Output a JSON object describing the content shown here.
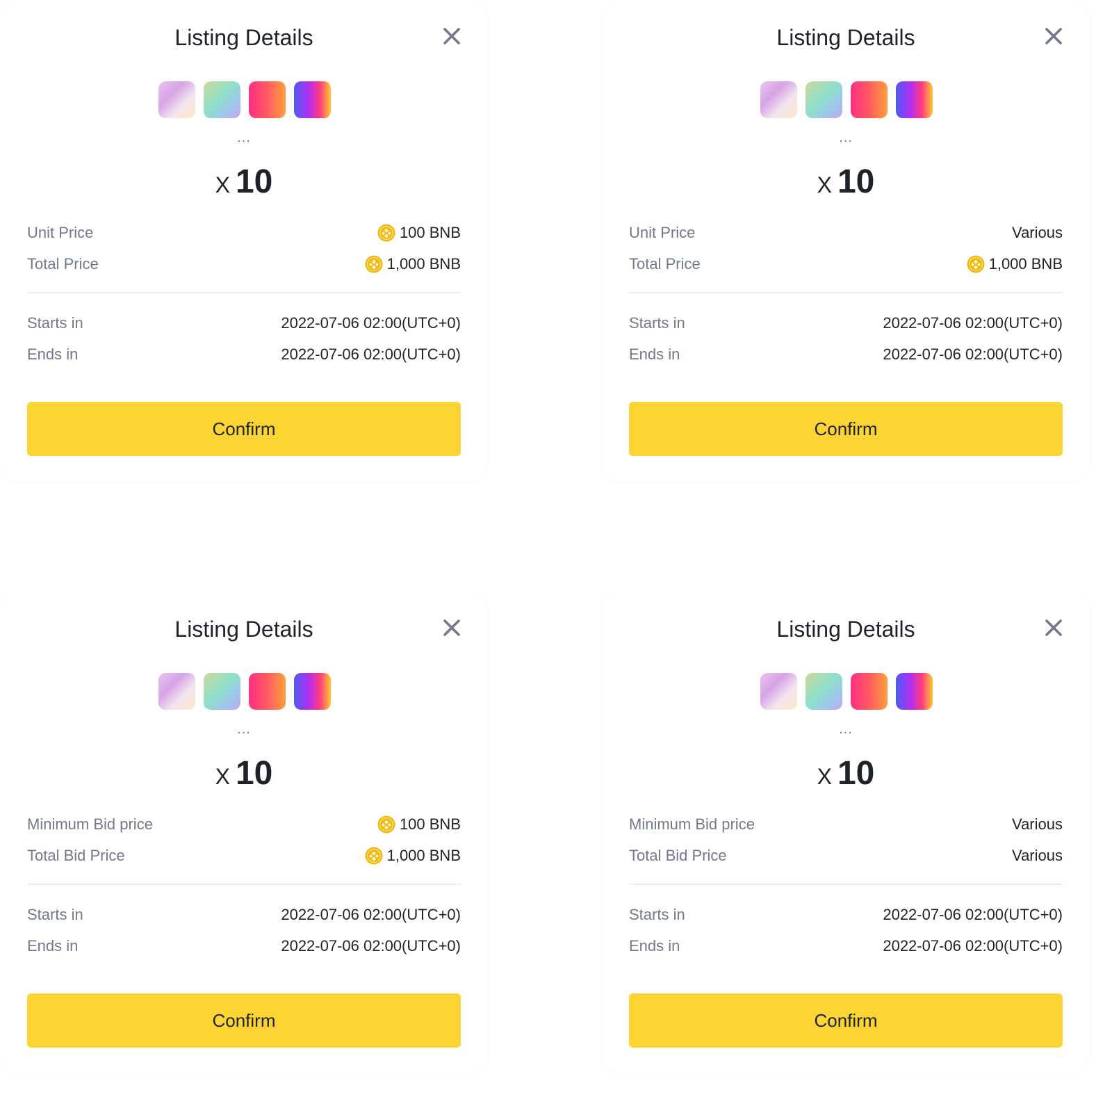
{
  "colors": {
    "accent_yellow": "#FCD535",
    "text_primary": "#1E2329",
    "text_secondary": "#707A8A",
    "divider": "#EAECEF",
    "bnb_coin": "#F0B90B"
  },
  "icons": {
    "close": "close-icon",
    "coin": "bnb-coin-icon"
  },
  "modals": [
    {
      "title": "Listing Details",
      "more_indicator": "...",
      "quantity_prefix": "X",
      "quantity": "10",
      "price_rows": [
        {
          "label": "Unit Price",
          "value": "100 BNB",
          "show_coin": true
        },
        {
          "label": "Total Price",
          "value": "1,000 BNB",
          "show_coin": true
        }
      ],
      "time_rows": [
        {
          "label": "Starts in",
          "value": "2022-07-06 02:00(UTC+0)"
        },
        {
          "label": "Ends in",
          "value": "2022-07-06 02:00(UTC+0)"
        }
      ],
      "confirm_label": "Confirm"
    },
    {
      "title": "Listing Details",
      "more_indicator": "...",
      "quantity_prefix": "X",
      "quantity": "10",
      "price_rows": [
        {
          "label": "Unit Price",
          "value": "Various",
          "show_coin": false
        },
        {
          "label": "Total Price",
          "value": "1,000 BNB",
          "show_coin": true
        }
      ],
      "time_rows": [
        {
          "label": "Starts in",
          "value": "2022-07-06 02:00(UTC+0)"
        },
        {
          "label": "Ends in",
          "value": "2022-07-06 02:00(UTC+0)"
        }
      ],
      "confirm_label": "Confirm"
    },
    {
      "title": "Listing Details",
      "more_indicator": "...",
      "quantity_prefix": "X",
      "quantity": "10",
      "price_rows": [
        {
          "label": "Minimum Bid price",
          "value": "100 BNB",
          "show_coin": true
        },
        {
          "label": "Total Bid Price",
          "value": "1,000 BNB",
          "show_coin": true
        }
      ],
      "time_rows": [
        {
          "label": "Starts in",
          "value": "2022-07-06 02:00(UTC+0)"
        },
        {
          "label": "Ends in",
          "value": "2022-07-06 02:00(UTC+0)"
        }
      ],
      "confirm_label": "Confirm"
    },
    {
      "title": "Listing Details",
      "more_indicator": "...",
      "quantity_prefix": "X",
      "quantity": "10",
      "price_rows": [
        {
          "label": "Minimum Bid price",
          "value": "Various",
          "show_coin": false
        },
        {
          "label": "Total Bid Price",
          "value": "Various",
          "show_coin": false
        }
      ],
      "time_rows": [
        {
          "label": "Starts in",
          "value": "2022-07-06 02:00(UTC+0)"
        },
        {
          "label": "Ends in",
          "value": "2022-07-06 02:00(UTC+0)"
        }
      ],
      "confirm_label": "Confirm"
    }
  ]
}
